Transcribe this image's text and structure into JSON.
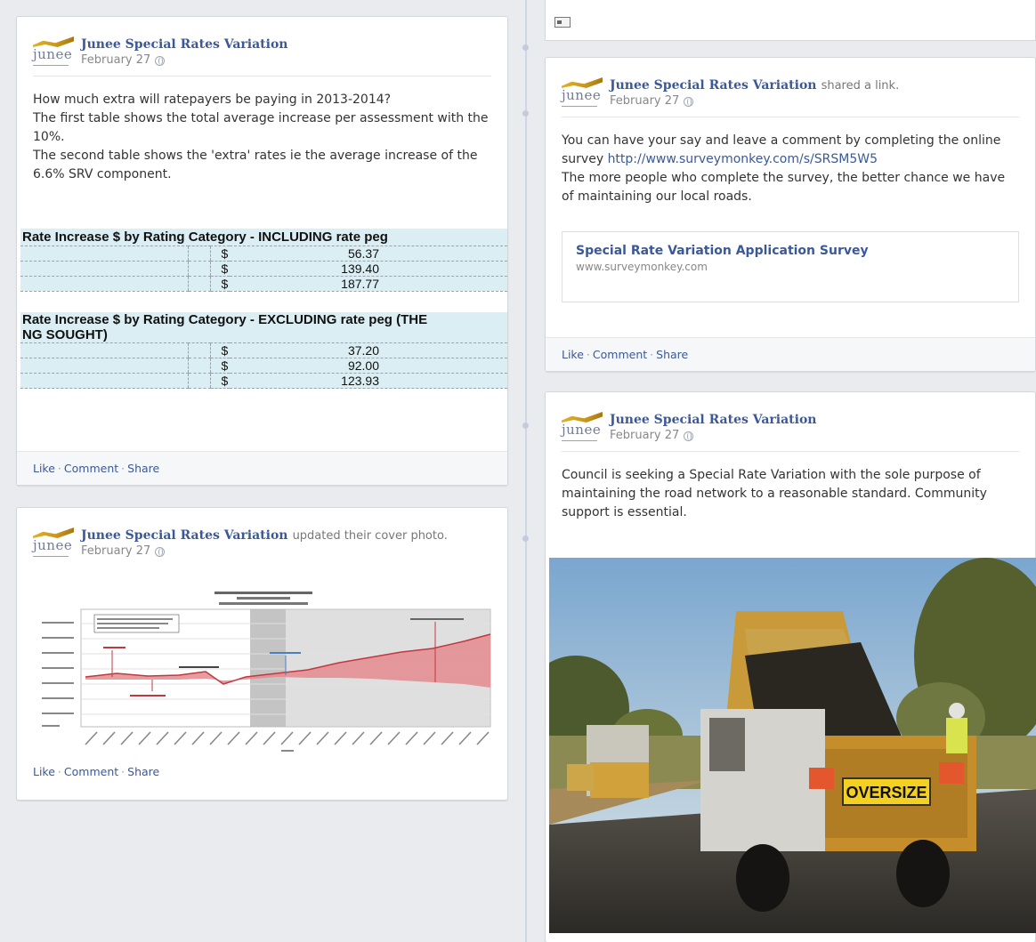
{
  "page": {
    "name": "Junee Special Rates Variation",
    "logo_text": "junee"
  },
  "posts": {
    "rates_table_post": {
      "date": "February 27",
      "lines": [
        "How much extra will ratepayers be paying in 2013-2014?",
        "The first table shows the total average increase per assessment with the 10%.",
        "The second table shows the 'extra' rates ie the average increase of the 6.6% SRV component."
      ],
      "table1_title": "Rate Increase $ by Rating Category  - INCLUDING  rate peg",
      "table1_rows": [
        {
          "currency": "$",
          "value": "56.37"
        },
        {
          "currency": "$",
          "value": "139.40"
        },
        {
          "currency": "$",
          "value": "187.77"
        }
      ],
      "table2_title": "Rate Increase $ by Rating Category  - EXCLUDING rate peg (THE",
      "table2_title_cont": "NG SOUGHT)",
      "table2_rows": [
        {
          "currency": "$",
          "value": "37.20"
        },
        {
          "currency": "$",
          "value": "92.00"
        },
        {
          "currency": "$",
          "value": "123.93"
        }
      ]
    },
    "cover_photo_post": {
      "action": "updated their cover photo.",
      "date": "February 27"
    },
    "link_post": {
      "action": "shared a link.",
      "date": "February 27",
      "text_before_link": "You can have your say and leave a comment by completing the online survey ",
      "link_url": "http://www.surveymonkey.com/s/SRSM5W5",
      "text_after": "The more people who complete the survey, the better chance we have of maintaining our local roads.",
      "card_title": "Special Rate Variation Application Survey",
      "card_domain": "www.surveymonkey.com"
    },
    "photo_post": {
      "date": "February 27",
      "text": "Council is seeking a Special Rate Variation with the sole purpose of maintaining the road network to a reasonable standard. Community support is essential.",
      "truck_sign": "OVERSIZE"
    }
  },
  "actions": {
    "like": "Like",
    "comment": "Comment",
    "share": "Share",
    "separator": "·"
  },
  "colors": {
    "link": "#3b5998",
    "table_bg": "#dbeef4",
    "chart_fill": "#e58b8f"
  }
}
